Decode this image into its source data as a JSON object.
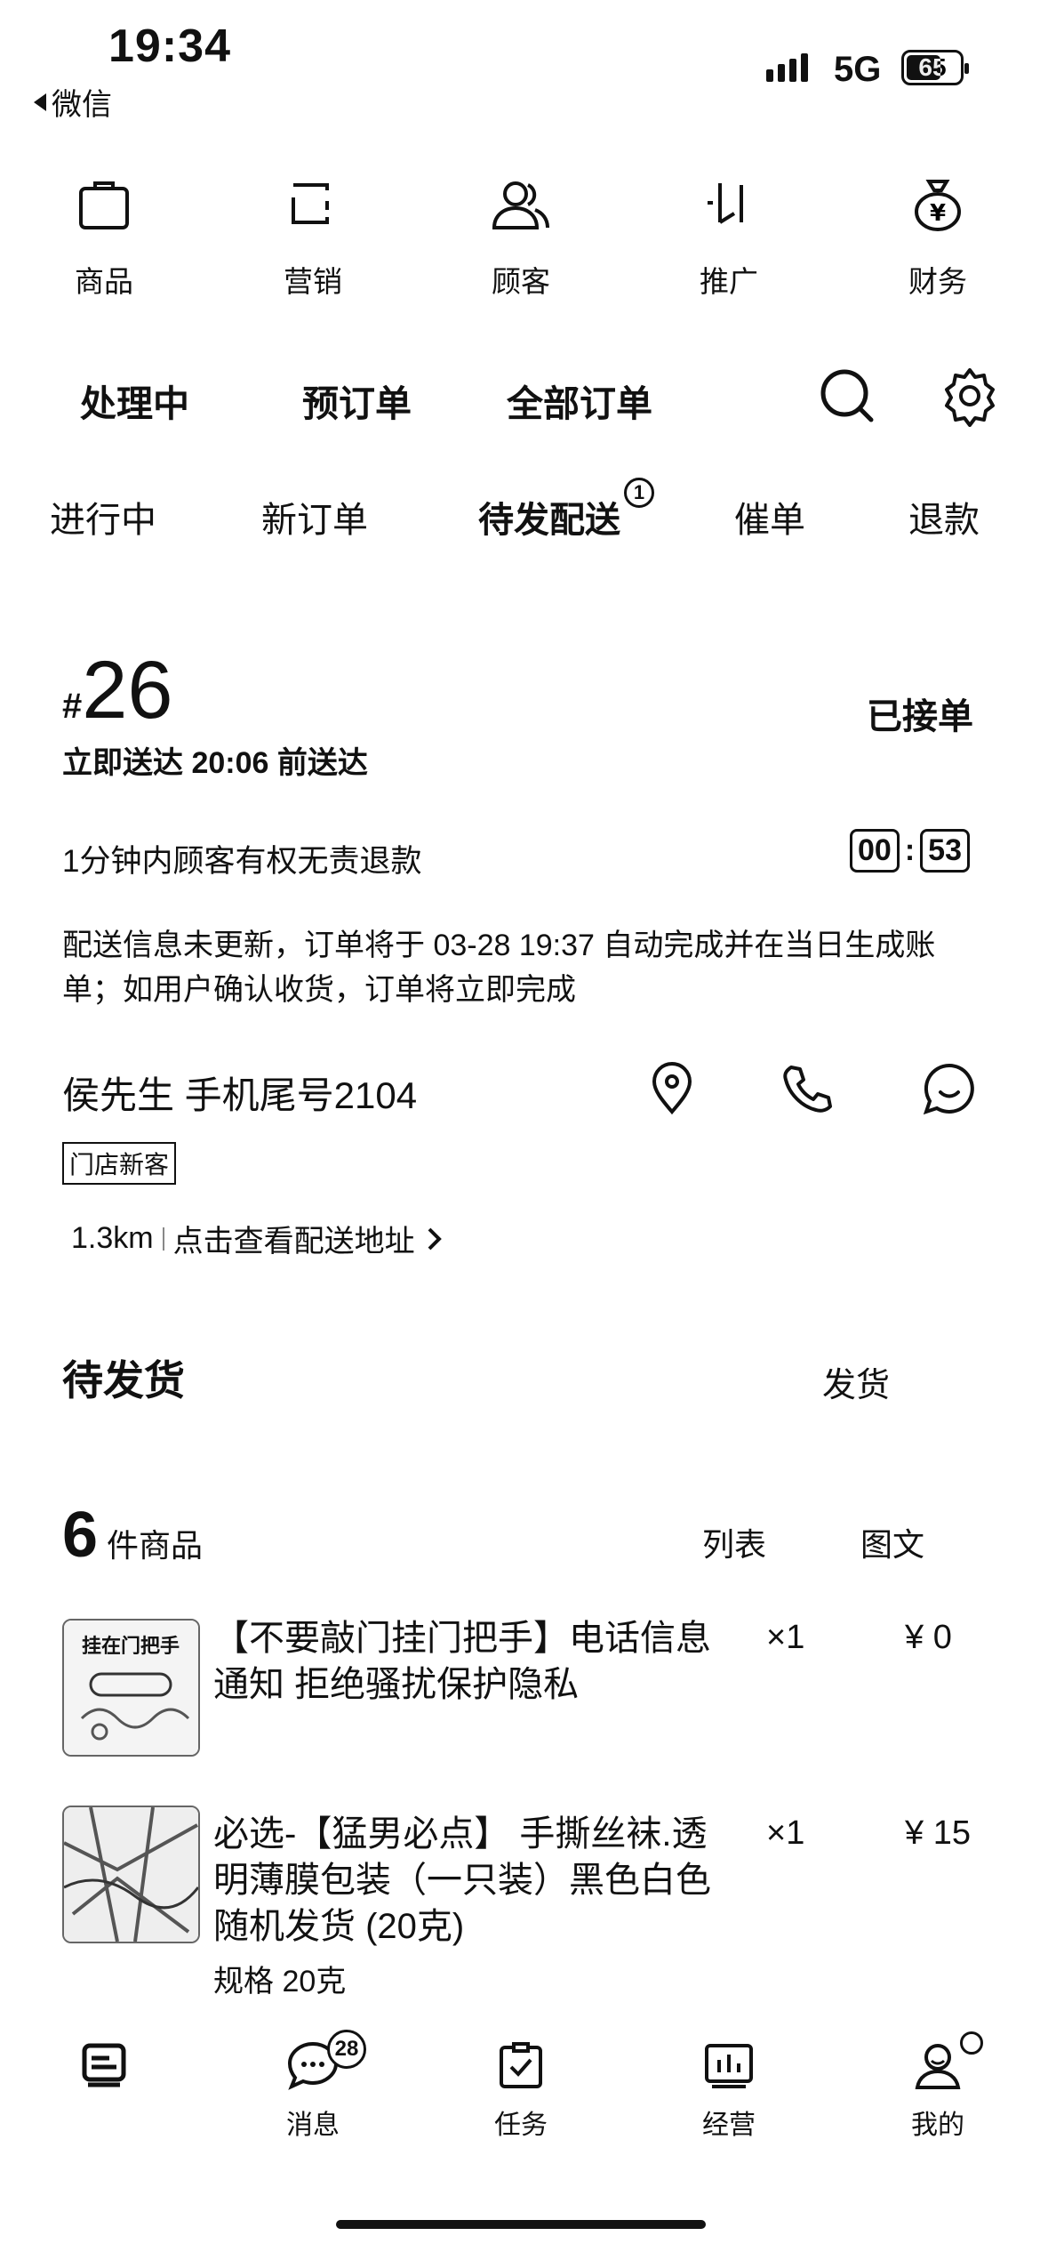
{
  "status_bar": {
    "time": "19:34",
    "back_label": "微信",
    "network": "5G",
    "battery": "65"
  },
  "tools": [
    {
      "label": "商品",
      "icon": "bag-icon"
    },
    {
      "label": "营销",
      "icon": "marketing-icon"
    },
    {
      "label": "顾客",
      "icon": "customers-icon"
    },
    {
      "label": "推广",
      "icon": "promotion-icon"
    },
    {
      "label": "财务",
      "icon": "money-bag-icon"
    }
  ],
  "order_tabs": [
    "处理中",
    "预订单",
    "全部订单"
  ],
  "status_tabs": [
    "进行中",
    "新订单",
    "待发配送",
    "催单",
    "退款"
  ],
  "status_tab_badge": "1",
  "order": {
    "hash": "#",
    "number": "26",
    "status": "已接单",
    "delivery": "立即送达 20:06 前送达",
    "refund_notice": "1分钟内顾客有权无责退款",
    "timer_min": "00",
    "timer_sep": ":",
    "timer_sec": "53",
    "notice": "配送信息未更新，订单将于 03-28 19:37 自动完成并在当日生成账单；如用户确认收货，订单将立即完成",
    "customer": "侯先生 手机尾号2104",
    "customer_tag": "门店新客",
    "distance": "1.3km",
    "address_link": "点击查看配送地址",
    "pending_title": "待发货",
    "ship_label": "发货",
    "item_count": "6",
    "item_count_unit": "件商品",
    "view_list": "列表",
    "view_grid": "图文"
  },
  "items": [
    {
      "name": "【不要敲门挂门把手】电话信息通知 拒绝骚扰保护隐私",
      "qty": "×1",
      "price": "¥ 0",
      "spec": "",
      "thumb_text": "挂在门把手"
    },
    {
      "name": "必选-【猛男必点】 手撕丝袜.透明薄膜包装（一只装）黑色白色随机发货 (20克)",
      "qty": "×1",
      "price": "¥ 15",
      "spec": "规格 20克",
      "thumb_text": ""
    }
  ],
  "bottom_nav": [
    {
      "label": "",
      "icon": "orders-icon"
    },
    {
      "label": "消息",
      "icon": "message-icon"
    },
    {
      "label": "任务",
      "icon": "task-icon"
    },
    {
      "label": "经营",
      "icon": "chart-icon"
    },
    {
      "label": "我的",
      "icon": "profile-icon"
    }
  ],
  "message_badge": "28"
}
